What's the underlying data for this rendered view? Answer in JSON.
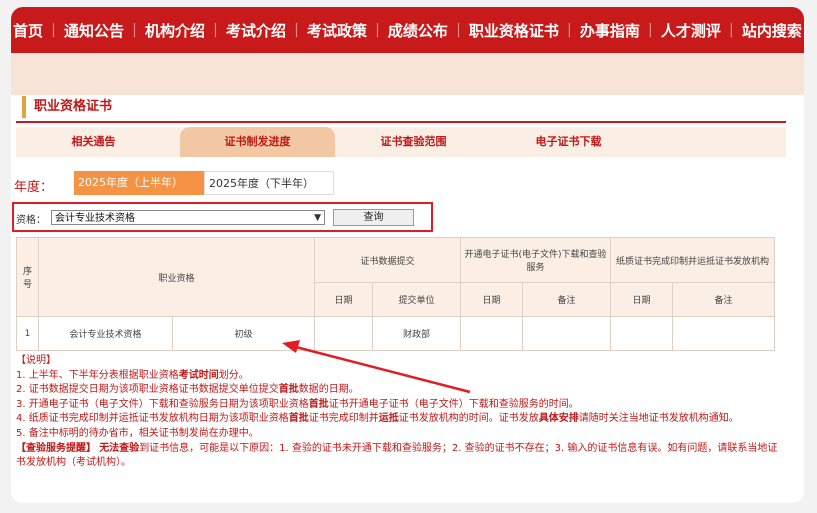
{
  "nav": {
    "items": [
      "首页",
      "通知公告",
      "机构介绍",
      "考试介绍",
      "考试政策",
      "成绩公布",
      "职业资格证书",
      "办事指南",
      "人才测评",
      "站内搜索"
    ]
  },
  "section": {
    "title": "职业资格证书"
  },
  "tabs": [
    "相关通告",
    "证书制发进度",
    "证书查验范围",
    "电子证书下载"
  ],
  "year": {
    "label": "年度：",
    "first_half": "2025年度（上半年）",
    "second_half": "2025年度（下半年）"
  },
  "query": {
    "label": "资格：",
    "selected": "会计专业技术资格",
    "button": "查询"
  },
  "table": {
    "h_seq": "序号",
    "h_qual": "职业资格",
    "h_submit": "证书数据提交",
    "h_ecert": "开通电子证书(电子文件)下载和查验服务",
    "h_paper": "纸质证书完成印制并运抵证书发放机构",
    "h_date": "日期",
    "h_unit": "提交单位",
    "h_note": "备注",
    "row": {
      "seq": "1",
      "qual": "会计专业技术资格",
      "level": "初级",
      "date1": "",
      "unit": "财政部",
      "date2": "",
      "note2": "",
      "date3": "",
      "note3": ""
    }
  },
  "notes": {
    "head": "【说明】",
    "n1a": "1. 上半年、下半年分表根据职业资格",
    "n1b": "考试时间",
    "n1c": "划分。",
    "n2a": "2. 证书数据提交日期为该项职业资格证书数据提交单位提交",
    "n2b": "首批",
    "n2c": "数据的日期。",
    "n3a": "3. 开通电子证书（电子文件）下载和查验服务日期为该项职业资格",
    "n3b": "首批",
    "n3c": "证书开通电子证书（电子文件）下载和查验服务的时间。",
    "n4a": "4. 纸质证书完成印制并运抵证书发放机构日期为该项职业资格",
    "n4b": "首批",
    "n4c": "证书完成印制并",
    "n4d": "运抵",
    "n4e": "证书发放机构的时间。证书发放",
    "n4f": "具体安排",
    "n4g": "请随时关注当地证书发放机构通知。",
    "n5": "5. 备注中标明的待办省市，相关证书制发尚在办理中。",
    "r1": "【查验服务提醒】",
    "r2": "无法查验",
    "r3": "到证书信息，可能是以下原因：1. 查验的证书未开通下载和查验服务；2. 查验的证书不存在；3. 输入的证书信息有误。如有问题，请联系当地证书发放机构（考试机构）。"
  }
}
